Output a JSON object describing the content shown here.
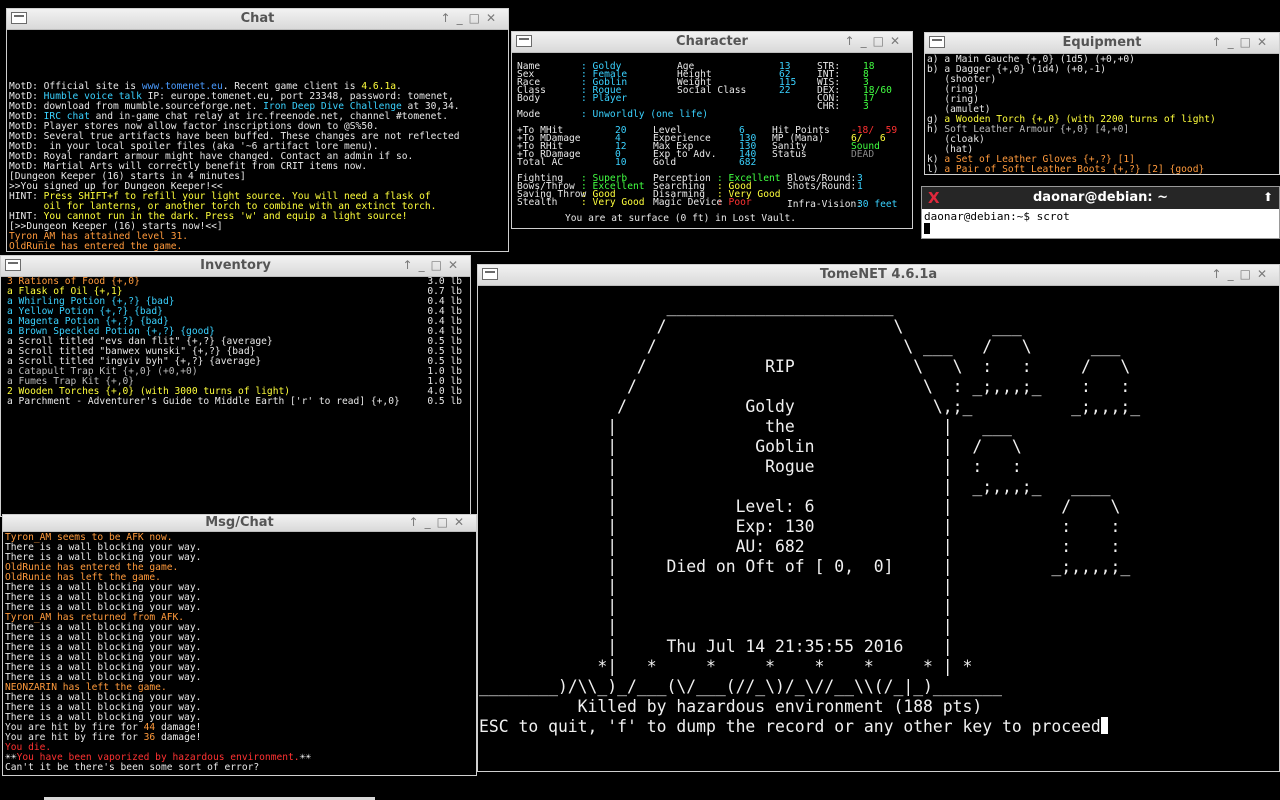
{
  "chat": {
    "title": "Chat",
    "lines": [
      [
        [
          "MotD: Official site is ",
          "w"
        ],
        [
          "www.tomenet.eu",
          "b"
        ],
        [
          ". Recent game client is ",
          "w"
        ],
        [
          "4.6.1a",
          "y"
        ],
        [
          ".",
          "w"
        ]
      ],
      [
        [
          "MotD: ",
          "w"
        ],
        [
          "Humble voice talk",
          "c"
        ],
        [
          " IP: europe.tomenet.eu, port 23348, password: tomenet,",
          "w"
        ]
      ],
      [
        [
          "MotD: download from mumble.sourceforge.net. ",
          "w"
        ],
        [
          "Iron Deep Dive Challenge",
          "c"
        ],
        [
          " at 30,34.",
          "w"
        ]
      ],
      [
        [
          "MotD: ",
          "w"
        ],
        [
          "IRC chat",
          "c"
        ],
        [
          " and in-game chat relay at irc.freenode.net, channel #tomenet.",
          "w"
        ]
      ],
      [
        [
          "MotD: Player stores now allow factor inscriptions down to @S%50.",
          "w"
        ]
      ],
      [
        [
          "MotD: Several true artifacts have been buffed. These changes are not reflected",
          "w"
        ]
      ],
      [
        [
          "MotD:  in your local spoiler files (aka '~6 artifact lore menu).",
          "w"
        ]
      ],
      [
        [
          "MotD: Royal randart armour might have changed. Contact an admin if so.",
          "w"
        ]
      ],
      [
        [
          "MotD: Martial Arts will correctly benefit from CRIT items now.",
          "w"
        ]
      ],
      [
        [
          "[Dungeon Keeper (16) starts in 4 minutes]",
          "w"
        ]
      ],
      [
        [
          ">>You signed up for Dungeon Keeper!<<",
          "w"
        ]
      ],
      [
        [
          "HINT: ",
          "w"
        ],
        [
          "Press SHIFT+f to refill your light source. You will need a flask of",
          "y"
        ]
      ],
      [
        [
          "      oil for lanterns, or another torch to combine with an extinct torch.",
          "y"
        ]
      ],
      [
        [
          "HINT: ",
          "w"
        ],
        [
          "You cannot run in the dark. Press 'w' and equip a light source!",
          "y"
        ]
      ],
      [
        [
          "[>>Dungeon Keeper (16) starts now!<<]",
          "w"
        ]
      ],
      [
        [
          "Tyron_AM has attained level 31.",
          "o"
        ]
      ],
      [
        [
          "OldRunie has entered the game.",
          "o"
        ]
      ]
    ]
  },
  "character": {
    "title": "Character",
    "col1": [
      [
        "Name",
        "Goldy"
      ],
      [
        "Sex",
        "Female"
      ],
      [
        "Race",
        "Goblin"
      ],
      [
        "Class",
        "Rogue"
      ],
      [
        "Body",
        "Player"
      ]
    ],
    "col2": [
      [
        "Age",
        "13"
      ],
      [
        "Height",
        "62"
      ],
      [
        "Weight",
        "115"
      ],
      [
        "Social Class",
        "22"
      ]
    ],
    "stats": [
      [
        "STR:",
        "18"
      ],
      [
        "INT:",
        "8"
      ],
      [
        "WIS:",
        "3"
      ],
      [
        "DEX:",
        "18/60"
      ],
      [
        "CON:",
        "17"
      ],
      [
        "CHR:",
        "3"
      ]
    ],
    "mode_label": "Mode",
    "mode_value": ": Unworldly (one life)",
    "combat": [
      [
        "+To MHit",
        "20"
      ],
      [
        "+To MDamage",
        "4"
      ],
      [
        "+To RHit",
        "12"
      ],
      [
        "+To RDamage",
        "0"
      ],
      [
        "Total AC",
        "10"
      ]
    ],
    "progress": [
      [
        "Level",
        "6"
      ],
      [
        "Experience",
        "130"
      ],
      [
        "Max Exp",
        "130"
      ],
      [
        "Exp to Adv.",
        "140"
      ],
      [
        "Gold",
        "682"
      ]
    ],
    "vitals_labels": [
      "Hit Points",
      "MP (Mana)",
      "Sanity",
      "Status"
    ],
    "vitals_values": [
      "-18/  59",
      "6/   6",
      "Sound",
      "DEAD"
    ],
    "skills": [
      [
        "Fighting",
        ": Superb"
      ],
      [
        "Bows/Throw",
        ": Excellent"
      ],
      [
        "Saving Throw",
        ": Good"
      ],
      [
        "Stealth",
        ": Very Good"
      ]
    ],
    "skills2": [
      [
        "Perception",
        ": Excellent"
      ],
      [
        "Searching",
        ": Good"
      ],
      [
        "Disarming",
        ": Very Good"
      ],
      [
        "Magic Device",
        ": Poor"
      ]
    ],
    "blows": [
      [
        "Blows/Round:",
        "3"
      ],
      [
        "Shots/Round:",
        "1"
      ],
      [
        "Infra-Vision:",
        "30 feet"
      ]
    ],
    "location": "You are at surface (0 ft) in Lost Vault."
  },
  "equipment": {
    "title": "Equipment",
    "lines": [
      [
        [
          "a) a Main Gauche {+,0} (1d5) (+0,+0)",
          "w"
        ]
      ],
      [
        [
          "b) a Dagger {+,0} (1d4) (+0,-1)",
          "w"
        ]
      ],
      [
        [
          "   (shooter)",
          "w"
        ]
      ],
      [
        [
          "   (ring)",
          "w"
        ]
      ],
      [
        [
          "   (ring)",
          "w"
        ]
      ],
      [
        [
          "   (amulet)",
          "w"
        ]
      ],
      [
        [
          "g) ",
          "w"
        ],
        [
          "a Wooden Torch {+,0} (with 2200 turns of light)",
          "y"
        ]
      ],
      [
        [
          "h) ",
          "w"
        ],
        [
          "Soft Leather Armour {+,0} [4,+0]",
          "gr"
        ]
      ],
      [
        [
          "   (cloak)",
          "w"
        ]
      ],
      [
        [
          "   (hat)",
          "w"
        ]
      ],
      [
        [
          "k) ",
          "w"
        ],
        [
          "a Set of Leather Gloves {+,?} [1]",
          "o"
        ]
      ],
      [
        [
          "l) ",
          "w"
        ],
        [
          "a Pair of Soft Leather Boots {+,?} [2] {good}",
          "o"
        ]
      ],
      [
        [
          "   (quiver)",
          "w"
        ]
      ],
      [
        [
          "   (tool)",
          "w"
        ]
      ]
    ]
  },
  "xterm": {
    "title": "daonar@debian: ~",
    "prompt": "daonar@debian:~$ scrot"
  },
  "inventory": {
    "title": "Inventory",
    "items": [
      [
        "3 Rations of Food {+,0}",
        "o",
        "3.0 lb"
      ],
      [
        "a Flask of Oil {+,1}",
        "y",
        "0.7 lb"
      ],
      [
        "a Whirling Potion {+,?} {bad}",
        "c",
        "0.4 lb"
      ],
      [
        "a Yellow Potion {+,?} {bad}",
        "c",
        "0.4 lb"
      ],
      [
        "a Magenta Potion {+,?} {bad}",
        "c",
        "0.4 lb"
      ],
      [
        "a Brown Speckled Potion {+,?} {good}",
        "c",
        "0.4 lb"
      ],
      [
        "a Scroll titled \"evs dan flit\" {+,?} {average}",
        "w",
        "0.5 lb"
      ],
      [
        "a Scroll titled \"banwex wunski\" {+,?} {bad}",
        "w",
        "0.5 lb"
      ],
      [
        "a Scroll titled \"ingviv byh\" {+,?} {average}",
        "w",
        "0.5 lb"
      ],
      [
        "a Catapult Trap Kit {+,0} (+0,+0)",
        "gr",
        "1.0 lb"
      ],
      [
        "a Fumes Trap Kit {+,0}",
        "gr",
        "1.0 lb"
      ],
      [
        "2 Wooden Torches {+,0} (with 3000 turns of light)",
        "y",
        "4.0 lb"
      ],
      [
        "a Parchment - Adventurer's Guide to Middle Earth ['r' to read] {+,0}",
        "w",
        "0.5 lb"
      ]
    ]
  },
  "msgchat": {
    "title": "Msg/Chat",
    "lines": [
      [
        [
          "Tyron_AM seems to be AFK now.",
          "o"
        ]
      ],
      [
        [
          "There is a wall blocking your way.",
          "w"
        ]
      ],
      [
        [
          "There is a wall blocking your way.",
          "w"
        ]
      ],
      [
        [
          "OldRunie has entered the game.",
          "o"
        ]
      ],
      [
        [
          "OldRunie has left the game.",
          "o"
        ]
      ],
      [
        [
          "There is a wall blocking your way.",
          "w"
        ]
      ],
      [
        [
          "There is a wall blocking your way.",
          "w"
        ]
      ],
      [
        [
          "There is a wall blocking your way.",
          "w"
        ]
      ],
      [
        [
          "Tyron_AM has returned from AFK.",
          "o"
        ]
      ],
      [
        [
          "There is a wall blocking your way.",
          "w"
        ]
      ],
      [
        [
          "There is a wall blocking your way.",
          "w"
        ]
      ],
      [
        [
          "There is a wall blocking your way.",
          "w"
        ]
      ],
      [
        [
          "There is a wall blocking your way.",
          "w"
        ]
      ],
      [
        [
          "There is a wall blocking your way.",
          "w"
        ]
      ],
      [
        [
          "There is a wall blocking your way.",
          "w"
        ]
      ],
      [
        [
          "NEONZARIN has left the game.",
          "o"
        ]
      ],
      [
        [
          "There is a wall blocking your way.",
          "w"
        ]
      ],
      [
        [
          "There is a wall blocking your way.",
          "w"
        ]
      ],
      [
        [
          "There is a wall blocking your way.",
          "w"
        ]
      ],
      [
        [
          "You are hit by fire for ",
          "w"
        ],
        [
          "44",
          "o"
        ],
        [
          " damage!",
          "w"
        ]
      ],
      [
        [
          "You are hit by fire for ",
          "w"
        ],
        [
          "36",
          "o"
        ],
        [
          " damage!",
          "w"
        ]
      ],
      [
        [
          "You die.",
          "r"
        ]
      ],
      [
        [
          "☀☀",
          "w"
        ],
        [
          "You have been vaporized by hazardous environment.",
          "r"
        ],
        [
          "☀☀",
          "w"
        ]
      ],
      [
        [
          "Can't it be there's been some sort of error?",
          "w"
        ]
      ]
    ]
  },
  "main": {
    "title": "TomeNET 4.6.1a",
    "art": [
      "",
      "                   _______________________",
      "                  /                       \\         ___",
      "                 /                         \\ ___   /   \\      ___",
      "                /            RIP            \\   \\  :   :     /   \\",
      "               /                             \\  : _;,,,;_    :   :",
      "              /            Goldy              \\,;_          _;,,,;_",
      "             |               the               |   ___",
      "             |              Goblin             |  /   \\",
      "             |               Rogue             |  :   :",
      "             |                                 |  _;,,,;_   ____",
      "             |            Level: 6             |           /    \\",
      "             |            Exp: 130             |           :    :",
      "             |            AU: 682              |           :    :",
      "             |     Died on Oft of [ 0,  0]     |          _;,,,,;_",
      "             |                                 |",
      "             |                                 |",
      "             |                                 |",
      "             |     Thu Jul 14 21:35:55 2016    |",
      "            *|   *     *     *    *    *     * | *",
      "________)/\\\\_)_/___(\\/___(//_\\)/_\\//__\\\\(/_|_)_______",
      "",
      "          Killed by hazardous environment (188 pts)",
      "",
      "ESC to quit, 'f' to dump the record or any other key to proceed"
    ]
  }
}
